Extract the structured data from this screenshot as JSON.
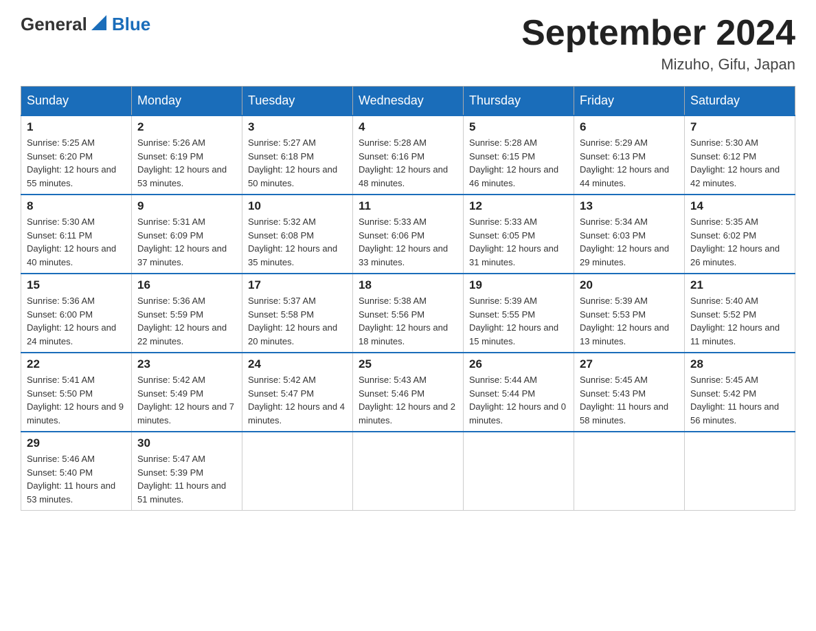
{
  "header": {
    "logo_general": "General",
    "logo_blue": "Blue",
    "title": "September 2024",
    "location": "Mizuho, Gifu, Japan"
  },
  "days_of_week": [
    "Sunday",
    "Monday",
    "Tuesday",
    "Wednesday",
    "Thursday",
    "Friday",
    "Saturday"
  ],
  "weeks": [
    [
      {
        "day": "1",
        "sunrise": "5:25 AM",
        "sunset": "6:20 PM",
        "daylight": "12 hours and 55 minutes."
      },
      {
        "day": "2",
        "sunrise": "5:26 AM",
        "sunset": "6:19 PM",
        "daylight": "12 hours and 53 minutes."
      },
      {
        "day": "3",
        "sunrise": "5:27 AM",
        "sunset": "6:18 PM",
        "daylight": "12 hours and 50 minutes."
      },
      {
        "day": "4",
        "sunrise": "5:28 AM",
        "sunset": "6:16 PM",
        "daylight": "12 hours and 48 minutes."
      },
      {
        "day": "5",
        "sunrise": "5:28 AM",
        "sunset": "6:15 PM",
        "daylight": "12 hours and 46 minutes."
      },
      {
        "day": "6",
        "sunrise": "5:29 AM",
        "sunset": "6:13 PM",
        "daylight": "12 hours and 44 minutes."
      },
      {
        "day": "7",
        "sunrise": "5:30 AM",
        "sunset": "6:12 PM",
        "daylight": "12 hours and 42 minutes."
      }
    ],
    [
      {
        "day": "8",
        "sunrise": "5:30 AM",
        "sunset": "6:11 PM",
        "daylight": "12 hours and 40 minutes."
      },
      {
        "day": "9",
        "sunrise": "5:31 AM",
        "sunset": "6:09 PM",
        "daylight": "12 hours and 37 minutes."
      },
      {
        "day": "10",
        "sunrise": "5:32 AM",
        "sunset": "6:08 PM",
        "daylight": "12 hours and 35 minutes."
      },
      {
        "day": "11",
        "sunrise": "5:33 AM",
        "sunset": "6:06 PM",
        "daylight": "12 hours and 33 minutes."
      },
      {
        "day": "12",
        "sunrise": "5:33 AM",
        "sunset": "6:05 PM",
        "daylight": "12 hours and 31 minutes."
      },
      {
        "day": "13",
        "sunrise": "5:34 AM",
        "sunset": "6:03 PM",
        "daylight": "12 hours and 29 minutes."
      },
      {
        "day": "14",
        "sunrise": "5:35 AM",
        "sunset": "6:02 PM",
        "daylight": "12 hours and 26 minutes."
      }
    ],
    [
      {
        "day": "15",
        "sunrise": "5:36 AM",
        "sunset": "6:00 PM",
        "daylight": "12 hours and 24 minutes."
      },
      {
        "day": "16",
        "sunrise": "5:36 AM",
        "sunset": "5:59 PM",
        "daylight": "12 hours and 22 minutes."
      },
      {
        "day": "17",
        "sunrise": "5:37 AM",
        "sunset": "5:58 PM",
        "daylight": "12 hours and 20 minutes."
      },
      {
        "day": "18",
        "sunrise": "5:38 AM",
        "sunset": "5:56 PM",
        "daylight": "12 hours and 18 minutes."
      },
      {
        "day": "19",
        "sunrise": "5:39 AM",
        "sunset": "5:55 PM",
        "daylight": "12 hours and 15 minutes."
      },
      {
        "day": "20",
        "sunrise": "5:39 AM",
        "sunset": "5:53 PM",
        "daylight": "12 hours and 13 minutes."
      },
      {
        "day": "21",
        "sunrise": "5:40 AM",
        "sunset": "5:52 PM",
        "daylight": "12 hours and 11 minutes."
      }
    ],
    [
      {
        "day": "22",
        "sunrise": "5:41 AM",
        "sunset": "5:50 PM",
        "daylight": "12 hours and 9 minutes."
      },
      {
        "day": "23",
        "sunrise": "5:42 AM",
        "sunset": "5:49 PM",
        "daylight": "12 hours and 7 minutes."
      },
      {
        "day": "24",
        "sunrise": "5:42 AM",
        "sunset": "5:47 PM",
        "daylight": "12 hours and 4 minutes."
      },
      {
        "day": "25",
        "sunrise": "5:43 AM",
        "sunset": "5:46 PM",
        "daylight": "12 hours and 2 minutes."
      },
      {
        "day": "26",
        "sunrise": "5:44 AM",
        "sunset": "5:44 PM",
        "daylight": "12 hours and 0 minutes."
      },
      {
        "day": "27",
        "sunrise": "5:45 AM",
        "sunset": "5:43 PM",
        "daylight": "11 hours and 58 minutes."
      },
      {
        "day": "28",
        "sunrise": "5:45 AM",
        "sunset": "5:42 PM",
        "daylight": "11 hours and 56 minutes."
      }
    ],
    [
      {
        "day": "29",
        "sunrise": "5:46 AM",
        "sunset": "5:40 PM",
        "daylight": "11 hours and 53 minutes."
      },
      {
        "day": "30",
        "sunrise": "5:47 AM",
        "sunset": "5:39 PM",
        "daylight": "11 hours and 51 minutes."
      },
      null,
      null,
      null,
      null,
      null
    ]
  ],
  "labels": {
    "sunrise": "Sunrise:",
    "sunset": "Sunset:",
    "daylight": "Daylight:"
  }
}
